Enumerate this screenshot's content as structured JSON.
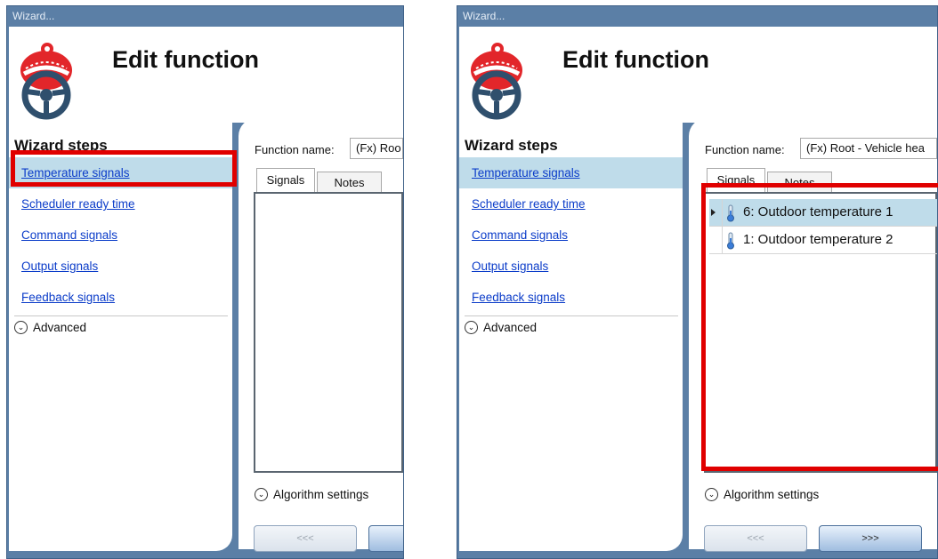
{
  "left": {
    "title_bar": "Wizard...",
    "header_title": "Edit function",
    "wizard_steps_title": "Wizard steps",
    "steps": [
      {
        "label": "Temperature signals"
      },
      {
        "label": "Scheduler ready time"
      },
      {
        "label": "Command signals"
      },
      {
        "label": "Output signals"
      },
      {
        "label": "Feedback signals"
      }
    ],
    "advanced_label": "Advanced",
    "function_name_label": "Function name:",
    "function_name_value": "(Fx) Roo",
    "tabs": {
      "signals": "Signals",
      "notes": "Notes"
    },
    "algorithm_settings_label": "Algorithm settings",
    "prev_button": "<<<"
  },
  "right": {
    "title_bar": "Wizard...",
    "header_title": "Edit function",
    "wizard_steps_title": "Wizard steps",
    "steps": [
      {
        "label": "Temperature signals"
      },
      {
        "label": "Scheduler ready time"
      },
      {
        "label": "Command signals"
      },
      {
        "label": "Output signals"
      },
      {
        "label": "Feedback signals"
      }
    ],
    "advanced_label": "Advanced",
    "function_name_label": "Function name:",
    "function_name_value": "(Fx) Root - Vehicle hea",
    "tabs": {
      "signals": "Signals",
      "notes": "Notes"
    },
    "signals": [
      {
        "label": "6: Outdoor temperature 1",
        "selected": true
      },
      {
        "label": "1: Outdoor temperature 2",
        "selected": false
      }
    ],
    "algorithm_settings_label": "Algorithm settings",
    "prev_button": "<<<",
    "next_button": ">>>"
  },
  "colors": {
    "window_frame": "#5b7fa6",
    "highlight": "#e00000",
    "selection": "#bfdcea",
    "link": "#0b3cc9"
  },
  "icons": [
    "steering-wheel-with-beanie-logo",
    "chevron-down-icon",
    "thermometer-icon",
    "row-pointer-icon"
  ]
}
